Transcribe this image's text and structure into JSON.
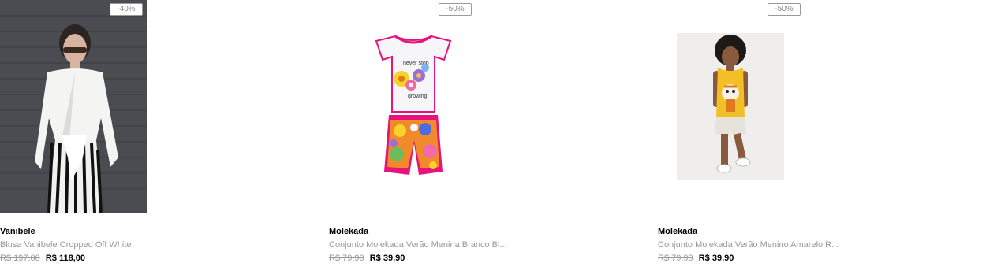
{
  "products": [
    {
      "badge": "-40%",
      "brand": "Vanibele",
      "title": "Blusa Vanibele Cropped Off White",
      "old_price": "R$ 197,00",
      "price": "R$ 118,00",
      "image": "woman-white-wrap-blouse-striped-pants-photo"
    },
    {
      "badge": "-50%",
      "brand": "Molekada",
      "title": "Conjunto Molekada Verão Menina Branco Bl...",
      "old_price": "R$ 79,90",
      "price": "R$ 39,90",
      "image": "girls-tshirt-and-flower-shorts-photo"
    },
    {
      "badge": "-50%",
      "brand": "Molekada",
      "title": "Conjunto Molekada Verão Menino Amarelo R...",
      "old_price": "R$ 79,90",
      "price": "R$ 39,90",
      "image": "boy-yellow-tank-top-tiger-photo"
    }
  ]
}
